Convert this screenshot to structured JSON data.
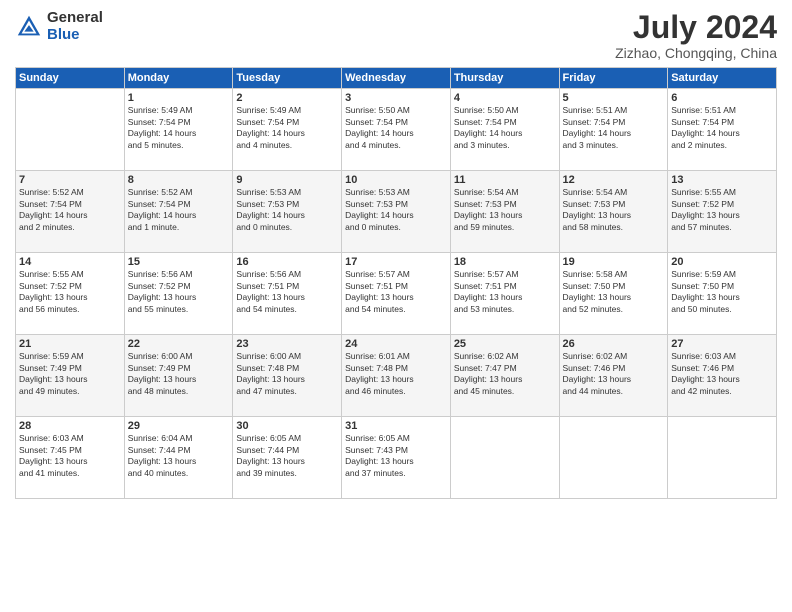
{
  "header": {
    "logo_general": "General",
    "logo_blue": "Blue",
    "month_title": "July 2024",
    "location": "Zizhao, Chongqing, China"
  },
  "days_of_week": [
    "Sunday",
    "Monday",
    "Tuesday",
    "Wednesday",
    "Thursday",
    "Friday",
    "Saturday"
  ],
  "weeks": [
    [
      {
        "day": "",
        "info": ""
      },
      {
        "day": "1",
        "info": "Sunrise: 5:49 AM\nSunset: 7:54 PM\nDaylight: 14 hours\nand 5 minutes."
      },
      {
        "day": "2",
        "info": "Sunrise: 5:49 AM\nSunset: 7:54 PM\nDaylight: 14 hours\nand 4 minutes."
      },
      {
        "day": "3",
        "info": "Sunrise: 5:50 AM\nSunset: 7:54 PM\nDaylight: 14 hours\nand 4 minutes."
      },
      {
        "day": "4",
        "info": "Sunrise: 5:50 AM\nSunset: 7:54 PM\nDaylight: 14 hours\nand 3 minutes."
      },
      {
        "day": "5",
        "info": "Sunrise: 5:51 AM\nSunset: 7:54 PM\nDaylight: 14 hours\nand 3 minutes."
      },
      {
        "day": "6",
        "info": "Sunrise: 5:51 AM\nSunset: 7:54 PM\nDaylight: 14 hours\nand 2 minutes."
      }
    ],
    [
      {
        "day": "7",
        "info": "Sunrise: 5:52 AM\nSunset: 7:54 PM\nDaylight: 14 hours\nand 2 minutes."
      },
      {
        "day": "8",
        "info": "Sunrise: 5:52 AM\nSunset: 7:54 PM\nDaylight: 14 hours\nand 1 minute."
      },
      {
        "day": "9",
        "info": "Sunrise: 5:53 AM\nSunset: 7:53 PM\nDaylight: 14 hours\nand 0 minutes."
      },
      {
        "day": "10",
        "info": "Sunrise: 5:53 AM\nSunset: 7:53 PM\nDaylight: 14 hours\nand 0 minutes."
      },
      {
        "day": "11",
        "info": "Sunrise: 5:54 AM\nSunset: 7:53 PM\nDaylight: 13 hours\nand 59 minutes."
      },
      {
        "day": "12",
        "info": "Sunrise: 5:54 AM\nSunset: 7:53 PM\nDaylight: 13 hours\nand 58 minutes."
      },
      {
        "day": "13",
        "info": "Sunrise: 5:55 AM\nSunset: 7:52 PM\nDaylight: 13 hours\nand 57 minutes."
      }
    ],
    [
      {
        "day": "14",
        "info": "Sunrise: 5:55 AM\nSunset: 7:52 PM\nDaylight: 13 hours\nand 56 minutes."
      },
      {
        "day": "15",
        "info": "Sunrise: 5:56 AM\nSunset: 7:52 PM\nDaylight: 13 hours\nand 55 minutes."
      },
      {
        "day": "16",
        "info": "Sunrise: 5:56 AM\nSunset: 7:51 PM\nDaylight: 13 hours\nand 54 minutes."
      },
      {
        "day": "17",
        "info": "Sunrise: 5:57 AM\nSunset: 7:51 PM\nDaylight: 13 hours\nand 54 minutes."
      },
      {
        "day": "18",
        "info": "Sunrise: 5:57 AM\nSunset: 7:51 PM\nDaylight: 13 hours\nand 53 minutes."
      },
      {
        "day": "19",
        "info": "Sunrise: 5:58 AM\nSunset: 7:50 PM\nDaylight: 13 hours\nand 52 minutes."
      },
      {
        "day": "20",
        "info": "Sunrise: 5:59 AM\nSunset: 7:50 PM\nDaylight: 13 hours\nand 50 minutes."
      }
    ],
    [
      {
        "day": "21",
        "info": "Sunrise: 5:59 AM\nSunset: 7:49 PM\nDaylight: 13 hours\nand 49 minutes."
      },
      {
        "day": "22",
        "info": "Sunrise: 6:00 AM\nSunset: 7:49 PM\nDaylight: 13 hours\nand 48 minutes."
      },
      {
        "day": "23",
        "info": "Sunrise: 6:00 AM\nSunset: 7:48 PM\nDaylight: 13 hours\nand 47 minutes."
      },
      {
        "day": "24",
        "info": "Sunrise: 6:01 AM\nSunset: 7:48 PM\nDaylight: 13 hours\nand 46 minutes."
      },
      {
        "day": "25",
        "info": "Sunrise: 6:02 AM\nSunset: 7:47 PM\nDaylight: 13 hours\nand 45 minutes."
      },
      {
        "day": "26",
        "info": "Sunrise: 6:02 AM\nSunset: 7:46 PM\nDaylight: 13 hours\nand 44 minutes."
      },
      {
        "day": "27",
        "info": "Sunrise: 6:03 AM\nSunset: 7:46 PM\nDaylight: 13 hours\nand 42 minutes."
      }
    ],
    [
      {
        "day": "28",
        "info": "Sunrise: 6:03 AM\nSunset: 7:45 PM\nDaylight: 13 hours\nand 41 minutes."
      },
      {
        "day": "29",
        "info": "Sunrise: 6:04 AM\nSunset: 7:44 PM\nDaylight: 13 hours\nand 40 minutes."
      },
      {
        "day": "30",
        "info": "Sunrise: 6:05 AM\nSunset: 7:44 PM\nDaylight: 13 hours\nand 39 minutes."
      },
      {
        "day": "31",
        "info": "Sunrise: 6:05 AM\nSunset: 7:43 PM\nDaylight: 13 hours\nand 37 minutes."
      },
      {
        "day": "",
        "info": ""
      },
      {
        "day": "",
        "info": ""
      },
      {
        "day": "",
        "info": ""
      }
    ]
  ]
}
